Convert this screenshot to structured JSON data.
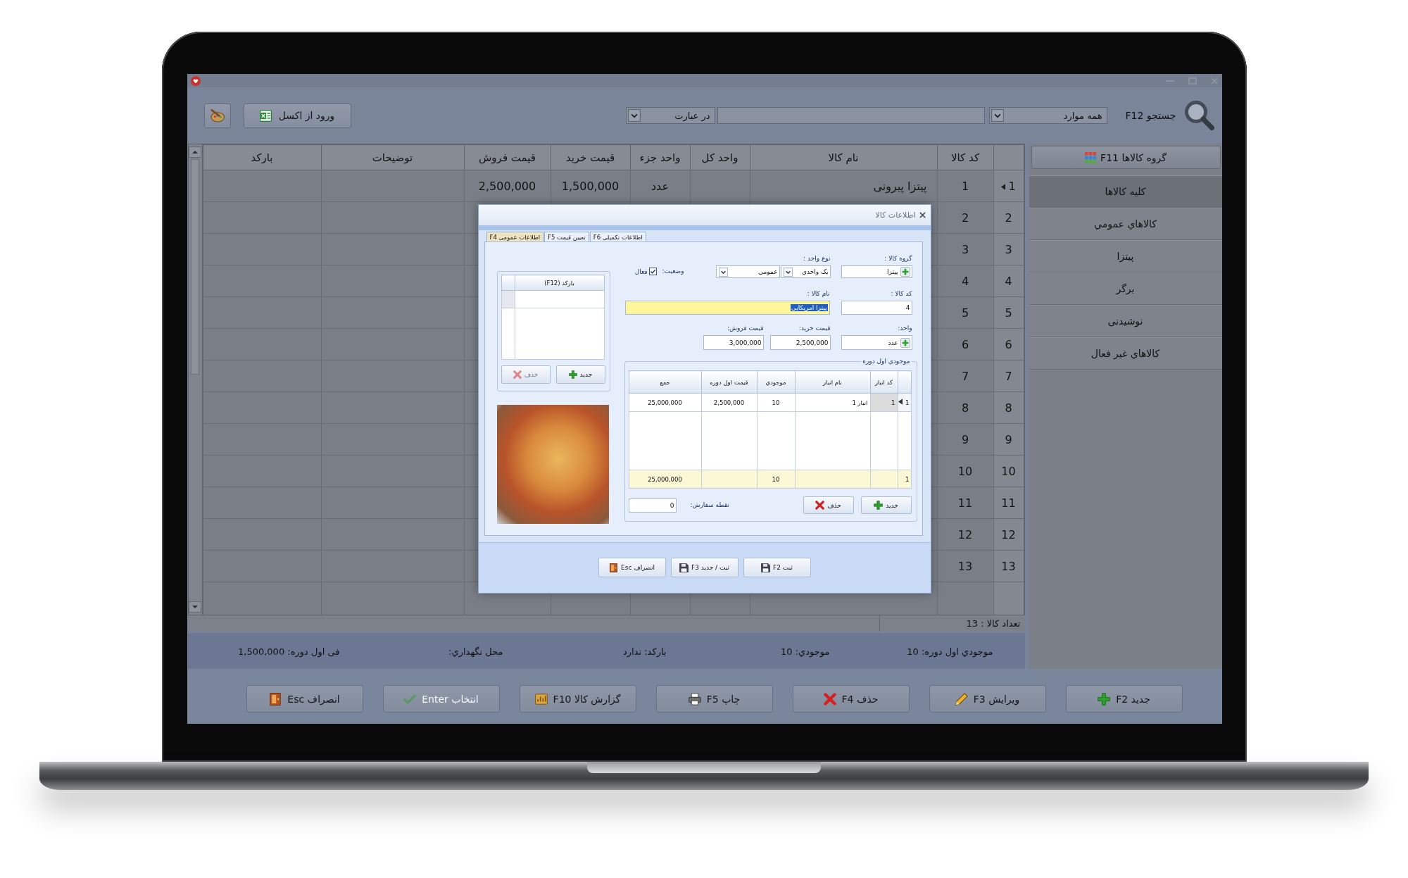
{
  "toolbar": {
    "import_button": "ورود از اکسل",
    "search": {
      "label": "جستجو F12",
      "scope": "همه موارد",
      "match_mode": "در عبارت"
    }
  },
  "sidebar": {
    "title": "گروه کالاها F11",
    "items": [
      {
        "label": "کلیه کالاها",
        "selected": true
      },
      {
        "label": "کالاهاي عمومي",
        "selected": false
      },
      {
        "label": "پیتزا",
        "selected": false
      },
      {
        "label": "برگر",
        "selected": false
      },
      {
        "label": "نوشیدنی",
        "selected": false
      },
      {
        "label": "کالاهاي غیر فعال",
        "selected": false
      }
    ]
  },
  "table": {
    "columns": [
      "کد کالا",
      "نام کالا",
      "واحد کل",
      "واحد جزء",
      "قیمت خرید",
      "قیمت فروش",
      "توضیحات",
      "بارکد"
    ],
    "rows": [
      {
        "number": "1",
        "selected": true,
        "cells": {
          "code": "1",
          "name": "پیتزا پیرونی",
          "minor_unit": "عدد",
          "purchase_price": "1,500,000",
          "sale_price": "2,500,000"
        }
      },
      {
        "number": "2",
        "selected": false,
        "cells": {
          "code": "2"
        }
      },
      {
        "number": "3",
        "selected": false,
        "cells": {
          "code": "3"
        }
      },
      {
        "number": "4",
        "selected": false,
        "cells": {
          "code": "4"
        }
      },
      {
        "number": "5",
        "selected": false,
        "cells": {
          "code": "5"
        }
      },
      {
        "number": "6",
        "selected": false,
        "cells": {
          "code": "6"
        }
      },
      {
        "number": "7",
        "selected": false,
        "cells": {
          "code": "7"
        }
      },
      {
        "number": "8",
        "selected": false,
        "cells": {
          "code": "8"
        }
      },
      {
        "number": "9",
        "selected": false,
        "cells": {
          "code": "9"
        }
      },
      {
        "number": "10",
        "selected": false,
        "cells": {
          "code": "10"
        }
      },
      {
        "number": "11",
        "selected": false,
        "cells": {
          "code": "11"
        }
      },
      {
        "number": "12",
        "selected": false,
        "cells": {
          "code": "12"
        }
      },
      {
        "number": "13",
        "selected": false,
        "cells": {
          "code": "13"
        }
      }
    ]
  },
  "item_count": "تعداد کالا : 13",
  "status_bar": [
    "موجودي اول دوره: 10",
    "موجودي: 10",
    "بارکد: ندارد",
    "محل نگهداري:",
    "فی اول دوره: 1,500,000"
  ],
  "buttons": [
    {
      "kind": "add",
      "label": "جدید F2",
      "disabled": false
    },
    {
      "kind": "edit",
      "label": "ویرایش F3",
      "disabled": false
    },
    {
      "kind": "delete",
      "label": "حذف F4",
      "disabled": false
    },
    {
      "kind": "print",
      "label": "چاپ F5",
      "disabled": false
    },
    {
      "kind": "report",
      "label": "گزارش کالا F10",
      "disabled": false
    },
    {
      "kind": "select",
      "label": "انتخاب Enter",
      "disabled": true
    },
    {
      "kind": "cancel",
      "label": "انصراف Esc",
      "disabled": false
    }
  ],
  "dialog": {
    "title": "اطلاعات کالا",
    "tabs": [
      {
        "label": "اطلاعات تکمیلی F6",
        "selected": false
      },
      {
        "label": "تعیین قیمت F5",
        "selected": false
      },
      {
        "label": "اطلاعات عمومی F4",
        "selected": true
      }
    ],
    "barcodes": {
      "column": "بارکد (F12)",
      "buttons": [
        {
          "kind": "add",
          "label": "جدید",
          "disabled": false
        },
        {
          "kind": "delete",
          "label": "حذف",
          "disabled": true
        }
      ]
    },
    "form": {
      "group": {
        "label": "گروه کالا :",
        "value": "پیتزا"
      },
      "unit_type": {
        "label": "نوع واحد :",
        "value": "یک واحدي"
      },
      "category": {
        "value": "عمومی"
      },
      "status": {
        "label": "وضعیت:",
        "option": "فعال",
        "checked": true
      },
      "code": {
        "label": "کد کالا :",
        "value": "4"
      },
      "name": {
        "label": "نام کالا :",
        "value": "پیتزا امریکایی",
        "focused": true,
        "text_selected": true
      },
      "unit": {
        "label": "واحد:",
        "value": "عدد"
      },
      "purchase_price": {
        "label": "قیمت خرید:",
        "value": "2,500,000"
      },
      "sale_price": {
        "label": "قیمت فروش:",
        "value": "3,000,000"
      }
    },
    "stock": {
      "title": "موجودي اول دوره",
      "columns": [
        "کد انبار",
        "نام انبار",
        "موجودي",
        "قیمت اول دوره",
        "جمع"
      ],
      "rows": [
        {
          "number": "1",
          "selected": true,
          "cells": [
            "1",
            "انبار 1",
            "10",
            "2,500,000",
            "25,000,000"
          ]
        }
      ],
      "footer": {
        "count": "1",
        "quantity": "10",
        "total": "25,000,000"
      },
      "buttons": [
        {
          "kind": "add",
          "label": "جدید",
          "disabled": false
        },
        {
          "kind": "delete",
          "label": "حذف",
          "disabled": false
        }
      ],
      "reorder_point": {
        "label": "نقطه سفارش:",
        "value": "0"
      }
    },
    "buttons": [
      {
        "kind": "save",
        "label": "ثبت F2"
      },
      {
        "kind": "save_new",
        "label": "ثبت / جدید F3"
      },
      {
        "kind": "cancel",
        "label": "انصراف Esc"
      }
    ]
  }
}
